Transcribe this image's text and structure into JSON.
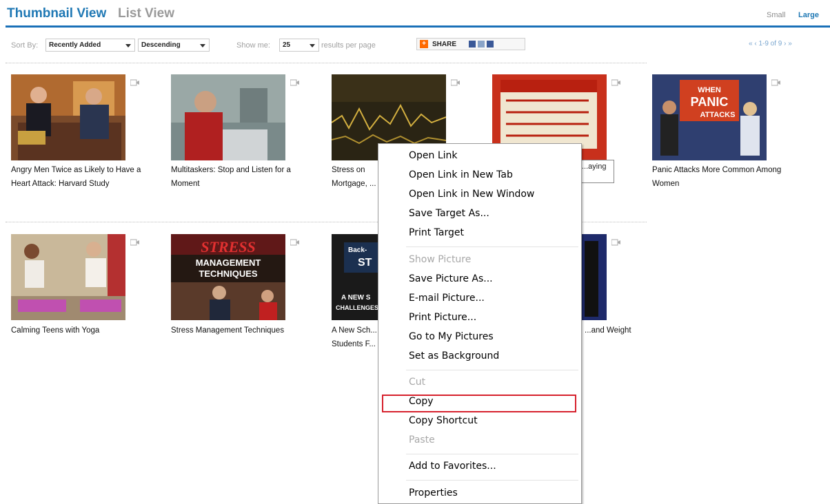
{
  "tabs": {
    "thumbnail": "Thumbnail View",
    "list": "List View"
  },
  "size_toggle": {
    "small": "Small",
    "large": "Large"
  },
  "toolbar": {
    "sort_label": "Sort By:",
    "sort_value": "Recently Added",
    "order_value": "Descending",
    "show_label": "Show me:",
    "show_value": "25",
    "per_page": "results per page",
    "share_label": "SHARE",
    "pager": "« ‹ 1-9 of 9 › »"
  },
  "items": [
    {
      "title": "Angry Men Twice as Likely to Have a Heart Attack: Harvard Study"
    },
    {
      "title": "Multitaskers: Stop and Listen for a Moment"
    },
    {
      "title": "Stress on Mortgage, ..."
    },
    {
      "title": "...aying"
    },
    {
      "title": "Panic Attacks More Common Among Women"
    },
    {
      "title": "Calming Teens with Yoga"
    },
    {
      "title": "Stress Management Techniques"
    },
    {
      "title": "A New Sch... Students F..."
    },
    {
      "title": "...and Weight"
    }
  ],
  "thumb_text": {
    "panic": "WHEN PANIC ATTACKS",
    "stress": "STRESS",
    "management": "MANAGEMENT TECHNIQUES",
    "back": "Back-",
    "st": "ST",
    "a_new": "A NEW S",
    "challenges": "CHALLENGES"
  },
  "context_menu": [
    {
      "label": "Open Link",
      "disabled": false
    },
    {
      "label": "Open Link in New Tab",
      "disabled": false
    },
    {
      "label": "Open Link in New Window",
      "disabled": false
    },
    {
      "label": "Save Target As...",
      "disabled": false
    },
    {
      "label": "Print Target",
      "disabled": false
    },
    {
      "label": "Show Picture",
      "disabled": true
    },
    {
      "label": "Save Picture As...",
      "disabled": false
    },
    {
      "label": "E-mail Picture...",
      "disabled": false
    },
    {
      "label": "Print Picture...",
      "disabled": false
    },
    {
      "label": "Go to My Pictures",
      "disabled": false
    },
    {
      "label": "Set as Background",
      "disabled": false
    },
    {
      "label": "Cut",
      "disabled": true
    },
    {
      "label": "Copy",
      "disabled": false,
      "highlighted": true
    },
    {
      "label": "Copy Shortcut",
      "disabled": false
    },
    {
      "label": "Paste",
      "disabled": true
    },
    {
      "label": "Add to Favorites...",
      "disabled": false
    },
    {
      "label": "Properties",
      "disabled": false
    }
  ],
  "colors": {
    "accent": "#1f78b4",
    "highlight_border": "#d6202c"
  }
}
